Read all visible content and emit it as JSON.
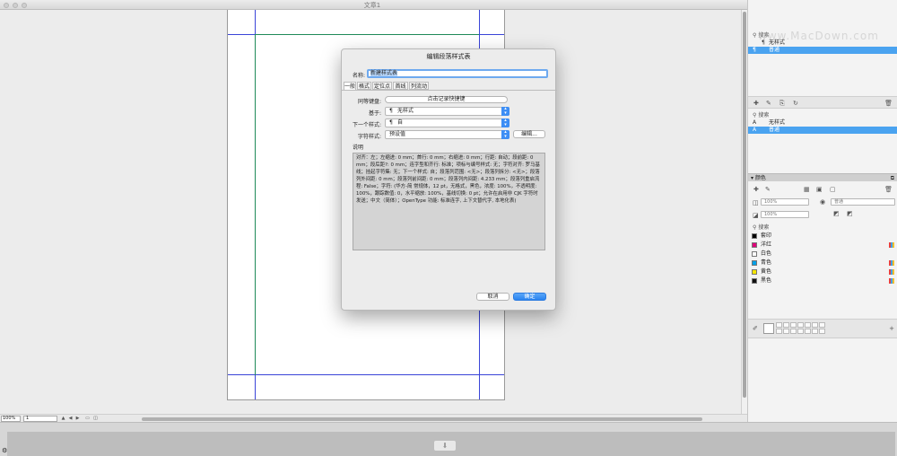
{
  "window": {
    "title": "文章1"
  },
  "status_bar": {
    "zoom": "100%",
    "page": "1"
  },
  "paragraph_styles_panel": {
    "search_label": "搜索",
    "items": [
      {
        "label": "无样式",
        "glyph": "¶",
        "selected": false
      },
      {
        "label": "普通",
        "glyph": "¶",
        "selected": true
      }
    ]
  },
  "character_styles_panel": {
    "search_label": "搜索",
    "items": [
      {
        "label": "无样式",
        "glyph": "A",
        "selected": false
      },
      {
        "label": "普通",
        "glyph": "A",
        "selected": true
      }
    ]
  },
  "colors_panel": {
    "title": "颜色",
    "fill_opacity": "100%",
    "stroke_opacity": "100%",
    "blend_mode": "普通",
    "search_label": "搜索",
    "swatches": [
      {
        "label": "套印",
        "color": "#000000",
        "cmyk": false
      },
      {
        "label": "洋红",
        "color": "#e0007a",
        "cmyk": true
      },
      {
        "label": "白色",
        "color": "#ffffff",
        "cmyk": false
      },
      {
        "label": "青色",
        "color": "#00a0e8",
        "cmyk": true
      },
      {
        "label": "黄色",
        "color": "#f5e600",
        "cmyk": true
      },
      {
        "label": "黑色",
        "color": "#111111",
        "cmyk": true
      }
    ]
  },
  "dialog": {
    "title": "编辑段落样式表",
    "name_label": "名称:",
    "name_value": "新建样式表",
    "tabs": [
      "一般",
      "格式",
      "定位点",
      "首线",
      "列流动"
    ],
    "shortcut_label": "同等键盘:",
    "shortcut_button": "点击记录快捷键",
    "based_on_label": "基于:",
    "based_on_value": "无样式",
    "next_style_label": "下一个样式:",
    "next_style_value": "自",
    "char_style_label": "字符样式:",
    "char_style_value": "预设值",
    "edit_button": "编辑...",
    "description_label": "说明",
    "description_text": "对齐：左；左缩进: 0 mm；首行: 0 mm；右缩进: 0 mm；行距: 自动；段前距: 0 mm；段后距?: 0 mm；连字型和齐行: 标准；项标与编号样式: 无；字符对齐: 罗马基线；挂起字符集: 无；下一个样式: 自；段落列范围: <无>；段落列拆分: <无>；段落列外间距: 0 mm；段落列前间距: 0 mm；段落列内间距: 4.233 mm；段落列重启流程: False；字符: (华方-简 常规体，12 pt，无格式，黑色，浓度: 100%，不透明度: 100%，跟踪数值: 0，水平缩放: 100%，基线切换: 0 pt；允许在启用非 CJK 字符时发送；中文（简体）；OpenType 功能: 标准连字, 上下文替代字, 本地化表)",
    "cancel_button": "取消",
    "ok_button": "确定"
  },
  "watermark": "www.MacDown.com"
}
